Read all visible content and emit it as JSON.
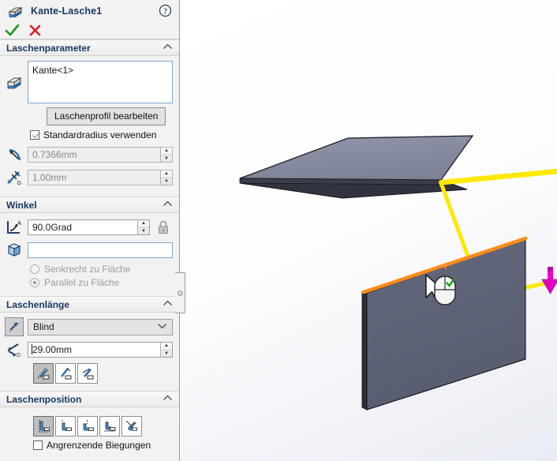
{
  "window": {
    "title": "Kante-Lasche1",
    "feature_icon": "edge-flange-icon",
    "help_icon": "help-icon",
    "ok_label": "OK",
    "cancel_label": "Abbrechen"
  },
  "sections": {
    "flange_parameters": {
      "title": "Laschenparameter",
      "collapse_icon": "chevron-up-icon",
      "edge_selection": {
        "icon": "edge-select-icon",
        "value": "Kante<1>"
      },
      "edit_profile_button": "Laschenprofil bearbeiten",
      "use_default_radius": {
        "label": "Standardradius verwenden",
        "checked": true
      },
      "bend_radius": {
        "icon": "bend-radius-icon",
        "value": "0.7366mm",
        "enabled": false
      },
      "gap_distance": {
        "icon": "gap-distance-icon",
        "value": "1.00mm",
        "enabled": false
      }
    },
    "angle": {
      "title": "Winkel",
      "collapse_icon": "chevron-up-icon",
      "flange_angle": {
        "icon": "flange-angle-icon",
        "value": "90.0Grad"
      },
      "lock_icon": "lock-icon",
      "reference_face": {
        "icon": "face-reference-icon",
        "value": "",
        "placeholder": ""
      },
      "options": [
        {
          "label": "Senkrecht zu Fläche",
          "selected": false
        },
        {
          "label": "Parallel zu Fläche",
          "selected": true
        }
      ]
    },
    "flange_length": {
      "title": "Laschenlänge",
      "collapse_icon": "chevron-up-icon",
      "end_condition": {
        "icon": "end-condition-icon",
        "value": "Blind",
        "arrow_icon": "chevron-down-icon"
      },
      "length": {
        "icon": "length-dimension-icon",
        "value": "29.00mm"
      },
      "measure_buttons": [
        {
          "name": "outer-virtual-sharp",
          "selected": true
        },
        {
          "name": "inner-virtual-sharp",
          "selected": false
        },
        {
          "name": "tangent-to-bend",
          "selected": false
        }
      ]
    },
    "flange_position": {
      "title": "Laschenposition",
      "collapse_icon": "chevron-up-icon",
      "position_buttons": [
        {
          "name": "material-inside",
          "selected": true
        },
        {
          "name": "bend-outside",
          "selected": false
        },
        {
          "name": "bend-from-virtual-sharp",
          "selected": false
        },
        {
          "name": "tangent-to-bend",
          "selected": false
        },
        {
          "name": "offset",
          "selected": false
        }
      ],
      "trim_side_bends": {
        "label": "Angrenzende Biegungen",
        "checked": false
      }
    }
  },
  "viewport": {
    "name": "graphics-area",
    "cursor_icon": "arrow-cursor-with-mouse-accept",
    "preview_color": "#ffff00",
    "selected_edge_color": "#ffe800",
    "highlight_edge_color": "#ff8c1a",
    "direction_arrow_color": "#ee00cc",
    "part_face_color": "#8a8fa3",
    "part_face_dark_color": "#5a5e70"
  }
}
